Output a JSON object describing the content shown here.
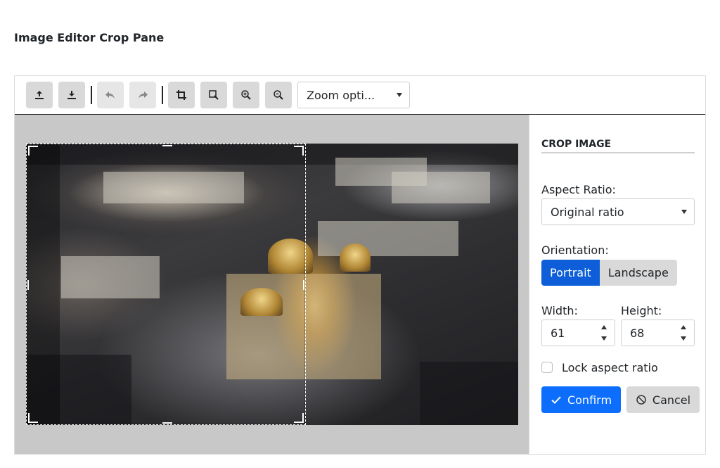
{
  "page": {
    "title": "Image Editor Crop Pane"
  },
  "toolbar": {
    "buttons": [
      {
        "name": "upload-button",
        "icon": "upload-icon",
        "enabled": true
      },
      {
        "name": "download-button",
        "icon": "download-icon",
        "enabled": true
      },
      {
        "name": "undo-button",
        "icon": "undo-icon",
        "enabled": false
      },
      {
        "name": "redo-button",
        "icon": "redo-icon",
        "enabled": false
      },
      {
        "name": "crop-button",
        "icon": "crop-icon",
        "enabled": true
      },
      {
        "name": "fit-button",
        "icon": "zoom-fit-icon",
        "enabled": true
      },
      {
        "name": "zoom-in-button",
        "icon": "zoom-in-icon",
        "enabled": true
      },
      {
        "name": "zoom-out-button",
        "icon": "zoom-out-icon",
        "enabled": true
      }
    ],
    "zoom_select": {
      "value": "Zoom opti..."
    }
  },
  "crop_panel": {
    "heading": "CROP IMAGE",
    "aspect_ratio_label": "Aspect Ratio:",
    "aspect_ratio_value": "Original ratio",
    "orientation_label": "Orientation:",
    "orientation_options": [
      "Portrait",
      "Landscape"
    ],
    "orientation_selected": "Portrait",
    "width_label": "Width:",
    "width_value": "61",
    "height_label": "Height:",
    "height_value": "68",
    "lock_label": "Lock aspect ratio",
    "lock_checked": false,
    "confirm_label": "Confirm",
    "cancel_label": "Cancel"
  },
  "colors": {
    "primary": "#0d6efd",
    "button_gray": "#d9d9d9",
    "canvas_bg": "#c8c8c8"
  }
}
